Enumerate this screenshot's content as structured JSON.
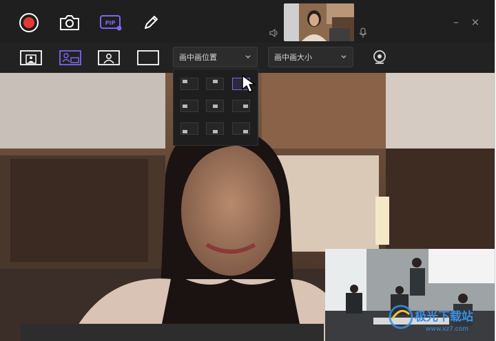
{
  "toolbar": {
    "record_button": "record",
    "screenshot_button": "camera",
    "pip_badge": "PIP",
    "edit_button": "pencil"
  },
  "window": {
    "minimize": "–",
    "close": "×"
  },
  "pip": {
    "position_placeholder": "画中画位置",
    "size_placeholder": "画中画大小",
    "selected_position": "top-right"
  },
  "layouts": [
    "pip-left",
    "pip-right",
    "person-only",
    "blank"
  ],
  "watermark": {
    "text": "极光下载站",
    "sub": "www.xz7.com"
  },
  "colors": {
    "accent": "#7b68ee",
    "record": "#e53935",
    "bg": "#1f1f1f"
  }
}
